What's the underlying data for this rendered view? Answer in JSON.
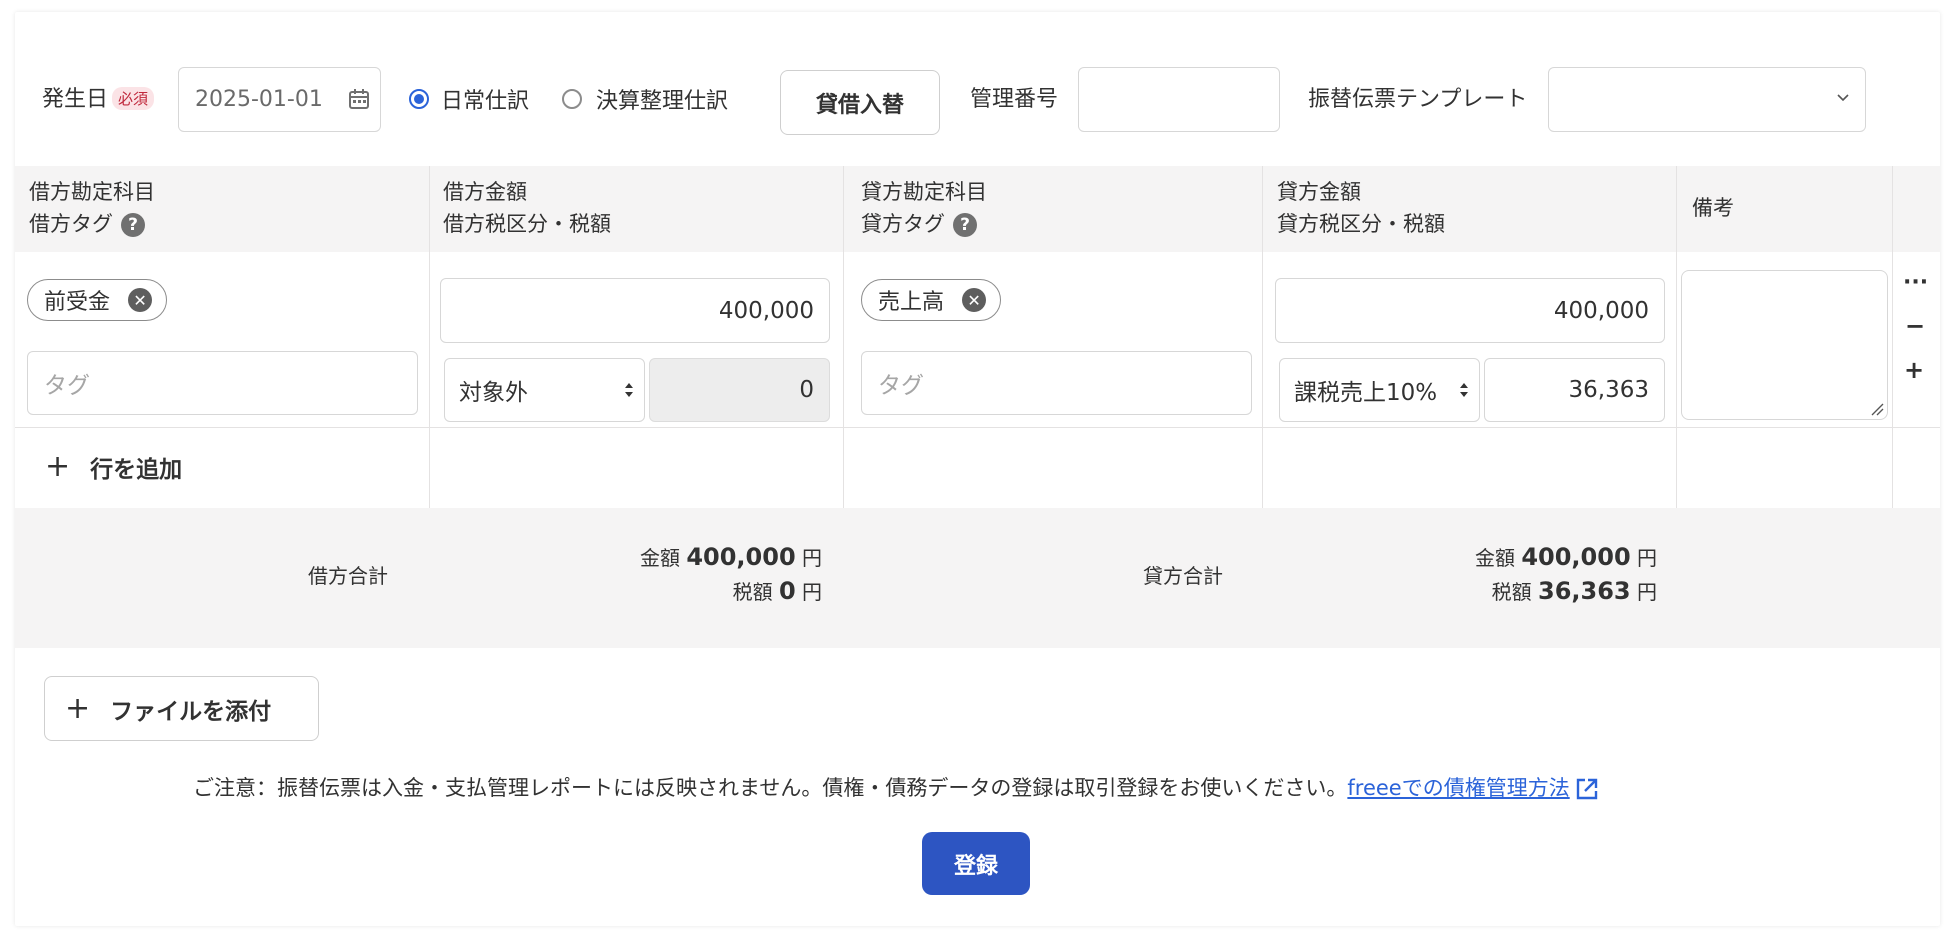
{
  "header": {
    "date_label": "発生日",
    "required_badge": "必須",
    "date_value": "2025-01-01",
    "radio_daily": "日常仕訳",
    "radio_closing": "決算整理仕訳",
    "swap_button": "貸借入替",
    "mgmt_no_label": "管理番号",
    "mgmt_no_value": "",
    "template_label": "振替伝票テンプレート",
    "template_value": ""
  },
  "table_header": {
    "debit_account": "借方勘定科目",
    "debit_tag": "借方タグ",
    "debit_amount": "借方金額",
    "debit_tax": "借方税区分・税額",
    "credit_account": "貸方勘定科目",
    "credit_tag": "貸方タグ",
    "credit_amount": "貸方金額",
    "credit_tax": "貸方税区分・税額",
    "note": "備考",
    "help": "?"
  },
  "row": {
    "debit_account": "前受金",
    "debit_tag_placeholder": "タグ",
    "debit_amount": "400,000",
    "debit_tax_category": "対象外",
    "debit_tax_amount": "0",
    "credit_account": "売上高",
    "credit_tag_placeholder": "タグ",
    "credit_amount": "400,000",
    "credit_tax_category": "課税売上10%",
    "credit_tax_amount": "36,363",
    "note": "",
    "menu": "···",
    "remove": "−",
    "add": "+"
  },
  "add_row": {
    "icon": "+",
    "label": "行を追加"
  },
  "totals": {
    "debit_label": "借方合計",
    "credit_label": "貸方合計",
    "amount_label": "金額",
    "tax_label": "税額",
    "unit": "円",
    "debit_amount": "400,000",
    "debit_tax": "0",
    "credit_amount": "400,000",
    "credit_tax": "36,363"
  },
  "attach": {
    "icon": "+",
    "label": "ファイルを添付"
  },
  "notice": {
    "text": "ご注意：振替伝票は入金・支払管理レポートには反映されません。債権・債務データの登録は取引登録をお使いください。",
    "link": "freeeでの債権管理方法"
  },
  "submit_label": "登録",
  "colors": {
    "primary": "#2d55c2",
    "link": "#2b63d9",
    "header_bg": "#f5f4f4"
  }
}
